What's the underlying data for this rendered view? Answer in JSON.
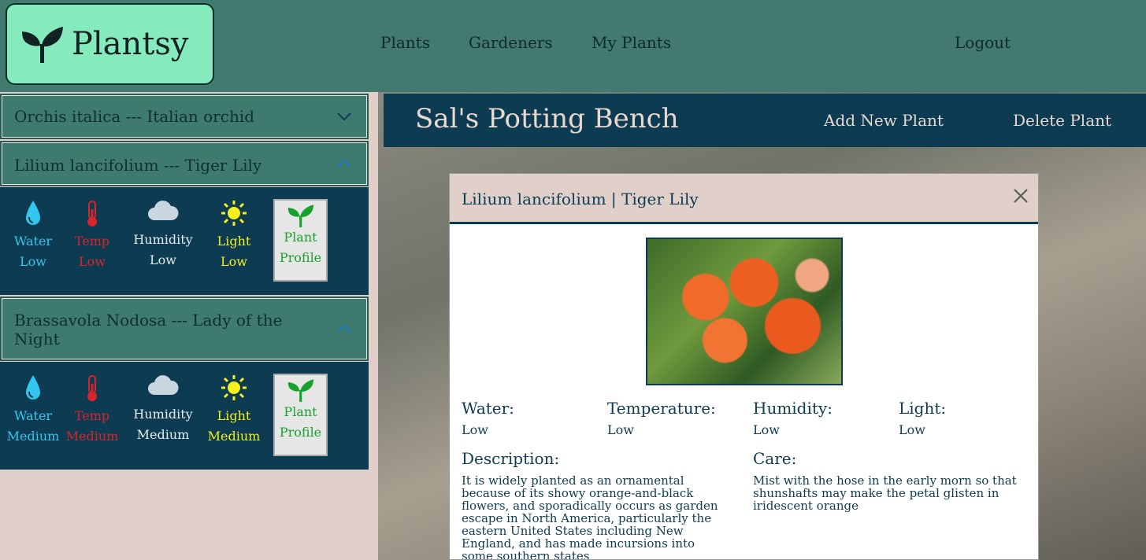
{
  "brand": {
    "name": "Plantsy"
  },
  "nav": {
    "plants": "Plants",
    "gardeners": "Gardeners",
    "my_plants": "My Plants",
    "logout": "Logout"
  },
  "sidebar": {
    "items": [
      {
        "title": "Orchis italica --- Italian orchid",
        "expanded": false
      },
      {
        "title": "Lilium lancifolium --- Tiger Lily",
        "expanded": true,
        "water": "Water",
        "water_level": "Low",
        "temp": "Temp",
        "temp_level": "Low",
        "humidity": "Humidity",
        "humidity_level": "Low",
        "light": "Light",
        "light_level": "Low",
        "profile": "Plant",
        "profile2": "Profile"
      },
      {
        "title": "Brassavola Nodosa --- Lady of the Night",
        "expanded": true,
        "water": "Water",
        "water_level": "Medium",
        "temp": "Temp",
        "temp_level": "Medium",
        "humidity": "Humidity",
        "humidity_level": "Medium",
        "light": "Light",
        "light_level": "Medium",
        "profile": "Plant",
        "profile2": "Profile"
      }
    ]
  },
  "main": {
    "title": "Sal's Potting Bench",
    "add": "Add New Plant",
    "delete": "Delete Plant"
  },
  "modal": {
    "title": "Lilium lancifolium | Tiger Lily",
    "water_label": "Water:",
    "water": "Low",
    "temp_label": "Temperature:",
    "temp": "Low",
    "humidity_label": "Humidity:",
    "humidity": "Low",
    "light_label": "Light:",
    "light": "Low",
    "description_label": "Description:",
    "description": "It is widely planted as an ornamental because of its showy orange-and-black flowers, and sporadically occurs as garden escape in North America, particularly the eastern United States including New England, and has made incursions into some southern states",
    "care_label": "Care:",
    "care": "Mist with the hose in the early morn so that shunshafts may make the petal glisten in iridescent orange"
  },
  "colors": {
    "water": "#33c6ee",
    "temp": "#d8242a",
    "humidity": "#e6eef2",
    "light": "#f5f01e",
    "profile": "#18a22c"
  }
}
